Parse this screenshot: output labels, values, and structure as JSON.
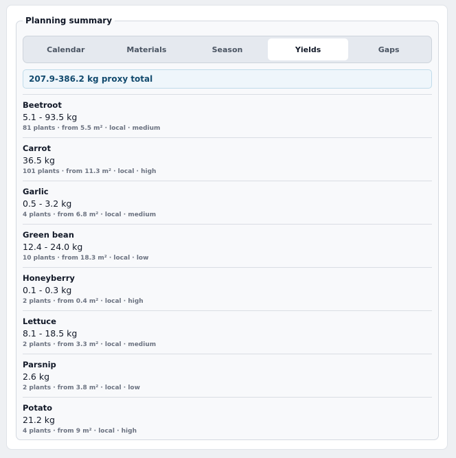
{
  "panel": {
    "title": "Planning summary"
  },
  "tabs": [
    {
      "label": "Calendar"
    },
    {
      "label": "Materials"
    },
    {
      "label": "Season"
    },
    {
      "label": "Yields"
    },
    {
      "label": "Gaps"
    }
  ],
  "active_tab": "Yields",
  "total": "207.9-386.2 kg proxy total",
  "crops": [
    {
      "name": "Beetroot",
      "yield": "5.1 - 93.5 kg",
      "details": "81 plants · from 5.5 m² · local · medium"
    },
    {
      "name": "Carrot",
      "yield": "36.5 kg",
      "details": "101 plants · from 11.3 m² · local · high"
    },
    {
      "name": "Garlic",
      "yield": "0.5 - 3.2 kg",
      "details": "4 plants · from 6.8 m² · local · medium"
    },
    {
      "name": "Green bean",
      "yield": "12.4 - 24.0 kg",
      "details": "10 plants · from 18.3 m² · local · low"
    },
    {
      "name": "Honeyberry",
      "yield": "0.1 - 0.3 kg",
      "details": "2 plants · from 0.4 m² · local · high"
    },
    {
      "name": "Lettuce",
      "yield": "8.1 - 18.5 kg",
      "details": "2 plants · from 3.3 m² · local · medium"
    },
    {
      "name": "Parsnip",
      "yield": "2.6 kg",
      "details": "2 plants · from 3.8 m² · local · low"
    },
    {
      "name": "Potato",
      "yield": "21.2 kg",
      "details": "4 plants · from 9 m² · local · high"
    }
  ]
}
